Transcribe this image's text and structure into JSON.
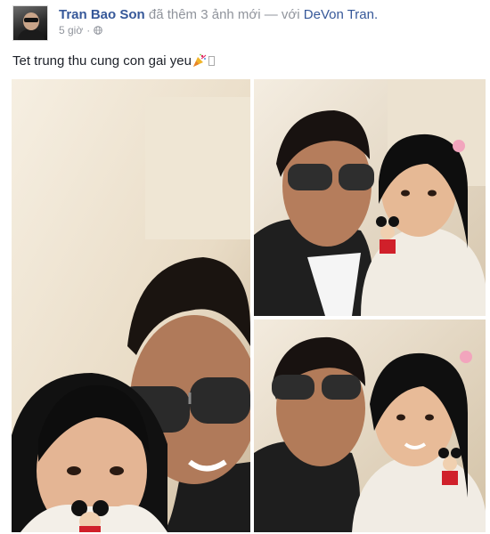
{
  "post": {
    "author": "Tran Bao Son",
    "action": " đã thêm 3 ảnh mới — với ",
    "tagged": "DeVon Tran.",
    "time": "5 giờ",
    "separator": " · ",
    "audience_icon": "globe-icon",
    "message": "Tet trung thu cung con gai yeu",
    "emoji_icon": "party-popper-icon"
  },
  "photos": [
    {
      "icon": "photo",
      "subject": "selfie-father-daughter"
    },
    {
      "icon": "photo",
      "subject": "selfie-father-daughter"
    },
    {
      "icon": "photo",
      "subject": "selfie-father-daughter"
    }
  ],
  "colors": {
    "link": "#365899",
    "meta": "#90949c",
    "text": "#1d2129"
  }
}
